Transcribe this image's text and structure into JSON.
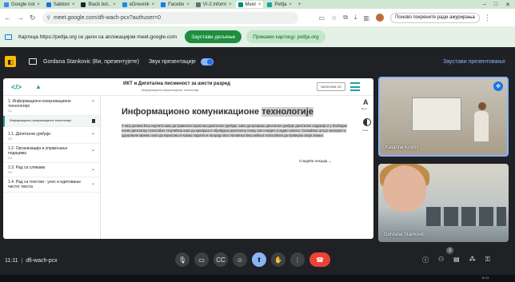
{
  "browser": {
    "tabs": [
      {
        "title": "Google not",
        "color": "#4285f4"
      },
      {
        "title": "Sabloni",
        "color": "#1a73e8"
      },
      {
        "title": "Black bol..",
        "color": "#222222"
      },
      {
        "title": "eDnevnik",
        "color": "#1e88e5"
      },
      {
        "title": "Facebo",
        "color": "#1877f2"
      },
      {
        "title": "VI-2 inform",
        "color": "#6c6c6c"
      },
      {
        "title": "Meet",
        "color": "#00897b"
      },
      {
        "title": "Petlja",
        "color": "#1ba39c"
      }
    ],
    "url": "meet.google.com/dfi-wach-pcx?authuser=0",
    "update_label": "Поново покрените ради ажурирања"
  },
  "share_bar": {
    "message": "Картица https://petlja.org се дели са апликацијом meet.google.com",
    "stop_label": "Заустави дељење",
    "show_tab_label": "Прикажи картицу: petlja.org"
  },
  "presentation_bar": {
    "presenter": "Gordana Stankovic (Ви, презентујете)",
    "audio_label": "Звук презентације",
    "stop_label": "Заустави презентовање"
  },
  "shared_page": {
    "header_title": "ИКТ и Дигитална писменост за шести разред",
    "header_subtitle": "Информационо-комуникационе технологије",
    "header_button": "ЗАПОЧНИ СЕ",
    "toc": [
      {
        "title": "1. Информационо комуникационе технологије",
        "num": "1/1",
        "expanded": true
      },
      {
        "title": "1.1. Дигитални уређаји",
        "num": "0/3"
      },
      {
        "title": "1.2. Организација и управљање подацима",
        "num": "0/3"
      },
      {
        "title": "1.3. Рад са сликама",
        "num": "0/3"
      },
      {
        "title": "1.4. Рад са текстом - унос и едитовање чистог текста",
        "num": ""
      }
    ],
    "toc_current": "Информационо комуникационе технологије",
    "lesson_title_plain": "Информационо комуникационе ",
    "lesson_title_highlight": "технологије",
    "lesson_body": "У овој целини ћеш научити како да правилно користиш дигиталне уређаје, како да креираш дигиталне уређаје дигиталне садржаје и у безбедан начин дигиталну оспособио. Научићеш како да креираш и обрађујеш дигиталну слику, као и видео и аудио записе. Сазнаћеш шта је интернет и друштвене мреже, како да користиш и чуваш податке и на крају овог поглавља ћеш моћи и оспособити да проверiш своје знање.",
    "next_label": "Следећа лекција",
    "tool_font_label": "Фонт",
    "tool_theme_label": "Тема"
  },
  "participants": [
    {
      "name": "Katarina Kojičić",
      "speaking": true
    },
    {
      "name": "Gordana Stankovic",
      "speaking": false
    }
  ],
  "bottom_bar": {
    "time": "11:11",
    "meeting_code": "dfi-wach-pcx",
    "participants_count": "3"
  },
  "taskbar": {
    "clock": "11:11"
  }
}
